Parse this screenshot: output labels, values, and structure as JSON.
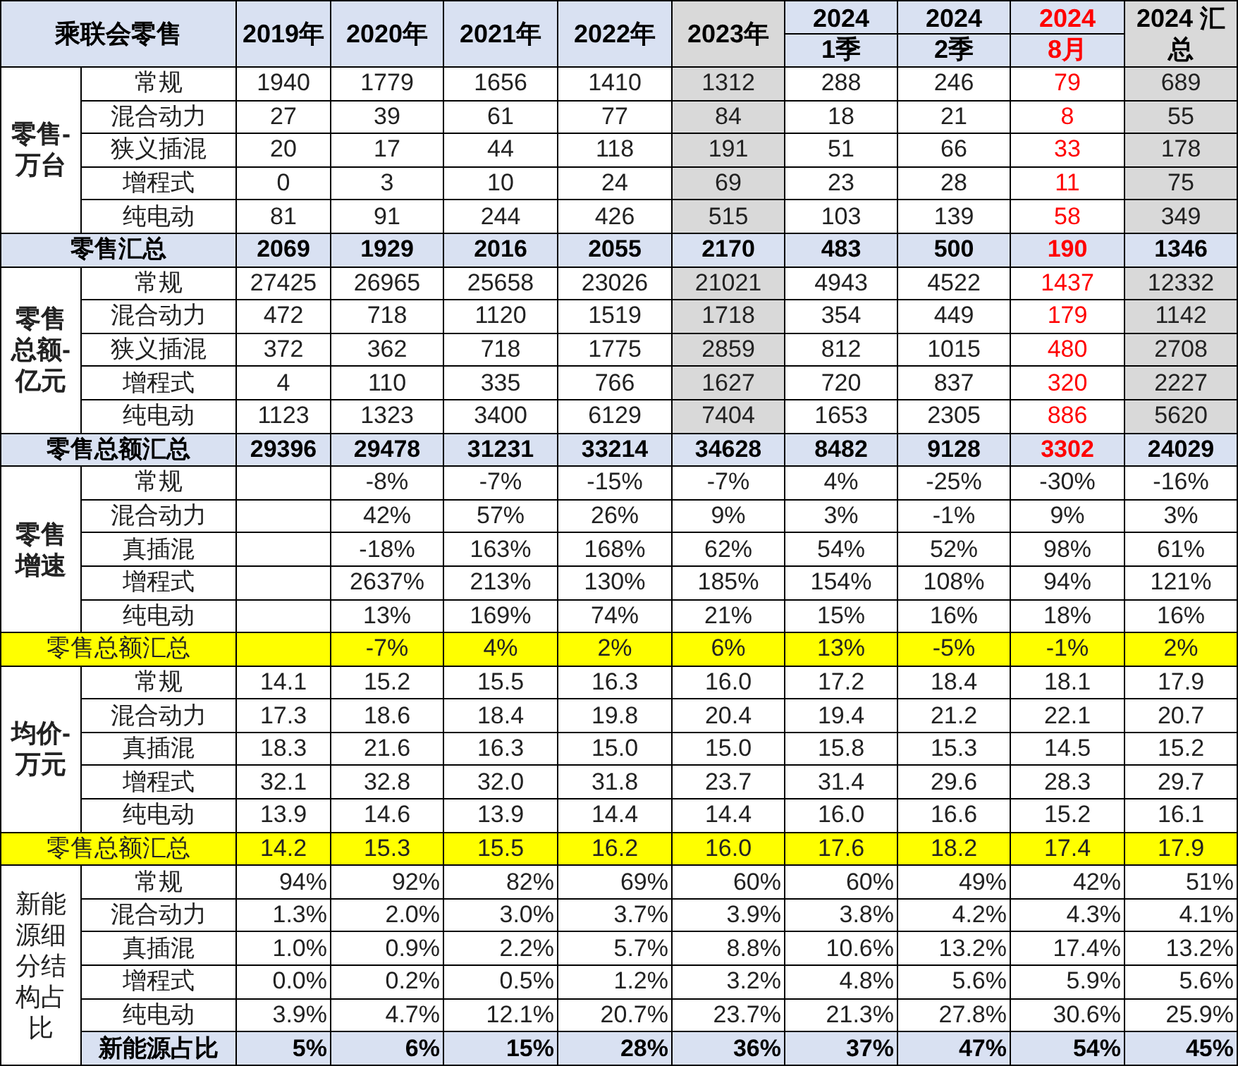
{
  "table": {
    "corner": "乘联会零售",
    "columns": [
      {
        "lines": [
          "2019年"
        ],
        "shaded": false,
        "red": false,
        "split": false
      },
      {
        "lines": [
          "2020年"
        ],
        "shaded": false,
        "red": false,
        "split": false
      },
      {
        "lines": [
          "2021年"
        ],
        "shaded": false,
        "red": false,
        "split": false
      },
      {
        "lines": [
          "2022年"
        ],
        "shaded": false,
        "red": false,
        "split": false
      },
      {
        "lines": [
          "2023年"
        ],
        "shaded": true,
        "red": false,
        "split": false
      },
      {
        "lines": [
          "2024",
          "1季"
        ],
        "shaded": false,
        "red": false,
        "split": true
      },
      {
        "lines": [
          "2024",
          "2季"
        ],
        "shaded": false,
        "red": false,
        "split": true
      },
      {
        "lines": [
          "2024",
          "8月"
        ],
        "shaded": false,
        "red": true,
        "split": true
      },
      {
        "lines": [
          "2024 汇",
          "总"
        ],
        "shaded": true,
        "red": false,
        "split": false
      }
    ],
    "sections": [
      {
        "lines": [
          "零售-",
          "万台"
        ],
        "label_bold": true,
        "column_styles": true,
        "right_aligned": false,
        "rows": [
          {
            "name": "常规",
            "values": [
              "1940",
              "1779",
              "1656",
              "1410",
              "1312",
              "288",
              "246",
              "79",
              "689"
            ]
          },
          {
            "name": "混合动力",
            "values": [
              "27",
              "39",
              "61",
              "77",
              "84",
              "18",
              "21",
              "8",
              "55"
            ]
          },
          {
            "name": "狭义插混",
            "values": [
              "20",
              "17",
              "44",
              "118",
              "191",
              "51",
              "66",
              "33",
              "178"
            ]
          },
          {
            "name": "增程式",
            "values": [
              "0",
              "3",
              "10",
              "24",
              "69",
              "23",
              "28",
              "11",
              "75"
            ]
          },
          {
            "name": "纯电动",
            "values": [
              "81",
              "91",
              "244",
              "426",
              "515",
              "103",
              "139",
              "58",
              "349"
            ]
          }
        ],
        "total": {
          "kind": "band",
          "label": "零售汇总",
          "values": [
            "2069",
            "1929",
            "2016",
            "2055",
            "2170",
            "483",
            "500",
            "190",
            "1346"
          ]
        }
      },
      {
        "lines": [
          "零售",
          "总额-",
          "亿元"
        ],
        "label_bold": true,
        "column_styles": true,
        "right_aligned": false,
        "rows": [
          {
            "name": "常规",
            "values": [
              "27425",
              "26965",
              "25658",
              "23026",
              "21021",
              "4943",
              "4522",
              "1437",
              "12332"
            ]
          },
          {
            "name": "混合动力",
            "values": [
              "472",
              "718",
              "1120",
              "1519",
              "1718",
              "354",
              "449",
              "179",
              "1142"
            ]
          },
          {
            "name": "狭义插混",
            "values": [
              "372",
              "362",
              "718",
              "1775",
              "2859",
              "812",
              "1015",
              "480",
              "2708"
            ]
          },
          {
            "name": "增程式",
            "values": [
              "4",
              "110",
              "335",
              "766",
              "1627",
              "720",
              "837",
              "320",
              "2227"
            ]
          },
          {
            "name": "纯电动",
            "values": [
              "1123",
              "1323",
              "3400",
              "6129",
              "7404",
              "1653",
              "2305",
              "886",
              "5620"
            ]
          }
        ],
        "total": {
          "kind": "band",
          "label": "零售总额汇总",
          "values": [
            "29396",
            "29478",
            "31231",
            "33214",
            "34628",
            "8482",
            "9128",
            "3302",
            "24029"
          ]
        }
      },
      {
        "lines": [
          "零售",
          "增速"
        ],
        "label_bold": true,
        "column_styles": false,
        "right_aligned": false,
        "rows": [
          {
            "name": "常规",
            "values": [
              "-8%",
              "-7%",
              "-15%",
              "-7%",
              "4%",
              "-25%",
              "-30%",
              "-16%"
            ]
          },
          {
            "name": "混合动力",
            "values": [
              "42%",
              "57%",
              "26%",
              "9%",
              "3%",
              "-1%",
              "9%",
              "3%"
            ]
          },
          {
            "name": "真插混",
            "values": [
              "-18%",
              "163%",
              "168%",
              "62%",
              "54%",
              "52%",
              "98%",
              "61%"
            ]
          },
          {
            "name": "增程式",
            "values": [
              "2637%",
              "213%",
              "130%",
              "185%",
              "154%",
              "108%",
              "94%",
              "121%"
            ]
          },
          {
            "name": "纯电动",
            "values": [
              "13%",
              "169%",
              "74%",
              "21%",
              "15%",
              "16%",
              "18%",
              "16%"
            ]
          }
        ],
        "total": {
          "kind": "highlight",
          "label": "零售总额汇总",
          "values": [
            "-7%",
            "4%",
            "2%",
            "6%",
            "13%",
            "-5%",
            "-1%",
            "2%"
          ]
        }
      },
      {
        "lines": [
          "均价-",
          "万元"
        ],
        "label_bold": true,
        "column_styles": false,
        "right_aligned": false,
        "rows": [
          {
            "name": "常规",
            "values": [
              "14.1",
              "15.2",
              "15.5",
              "16.3",
              "16.0",
              "17.2",
              "18.4",
              "18.1",
              "17.9"
            ]
          },
          {
            "name": "混合动力",
            "values": [
              "17.3",
              "18.6",
              "18.4",
              "19.8",
              "20.4",
              "19.4",
              "21.2",
              "22.1",
              "20.7"
            ]
          },
          {
            "name": "真插混",
            "values": [
              "18.3",
              "21.6",
              "16.3",
              "15.0",
              "15.0",
              "15.8",
              "15.3",
              "14.5",
              "15.2"
            ]
          },
          {
            "name": "增程式",
            "values": [
              "32.1",
              "32.8",
              "32.0",
              "31.8",
              "23.7",
              "31.4",
              "29.6",
              "28.3",
              "29.7"
            ]
          },
          {
            "name": "纯电动",
            "values": [
              "13.9",
              "14.6",
              "13.9",
              "14.4",
              "14.4",
              "16.0",
              "16.6",
              "15.2",
              "16.1"
            ]
          }
        ],
        "total": {
          "kind": "highlight",
          "label": "零售总额汇总",
          "values": [
            "14.2",
            "15.3",
            "15.5",
            "16.2",
            "16.0",
            "17.6",
            "18.2",
            "17.4",
            "17.9"
          ]
        }
      },
      {
        "lines": [
          "新能",
          "源细",
          "分结",
          "构占",
          "比"
        ],
        "label_bold": false,
        "column_styles": false,
        "right_aligned": true,
        "rows": [
          {
            "name": "常规",
            "values": [
              "94%",
              "92%",
              "82%",
              "69%",
              "60%",
              "60%",
              "49%",
              "42%",
              "51%"
            ]
          },
          {
            "name": "混合动力",
            "values": [
              "1.3%",
              "2.0%",
              "3.0%",
              "3.7%",
              "3.9%",
              "3.8%",
              "4.2%",
              "4.3%",
              "4.1%"
            ]
          },
          {
            "name": "真插混",
            "values": [
              "1.0%",
              "0.9%",
              "2.2%",
              "5.7%",
              "8.8%",
              "10.6%",
              "13.2%",
              "17.4%",
              "13.2%"
            ]
          },
          {
            "name": "增程式",
            "values": [
              "0.0%",
              "0.2%",
              "0.5%",
              "1.2%",
              "3.2%",
              "4.8%",
              "5.6%",
              "5.9%",
              "5.6%"
            ]
          },
          {
            "name": "纯电动",
            "values": [
              "3.9%",
              "4.7%",
              "12.1%",
              "20.7%",
              "23.7%",
              "21.3%",
              "27.8%",
              "30.6%",
              "25.9%"
            ]
          }
        ],
        "total": {
          "kind": "footer",
          "label": "新能源占比",
          "values": [
            "5%",
            "6%",
            "15%",
            "28%",
            "36%",
            "37%",
            "47%",
            "54%",
            "45%"
          ]
        }
      }
    ]
  }
}
